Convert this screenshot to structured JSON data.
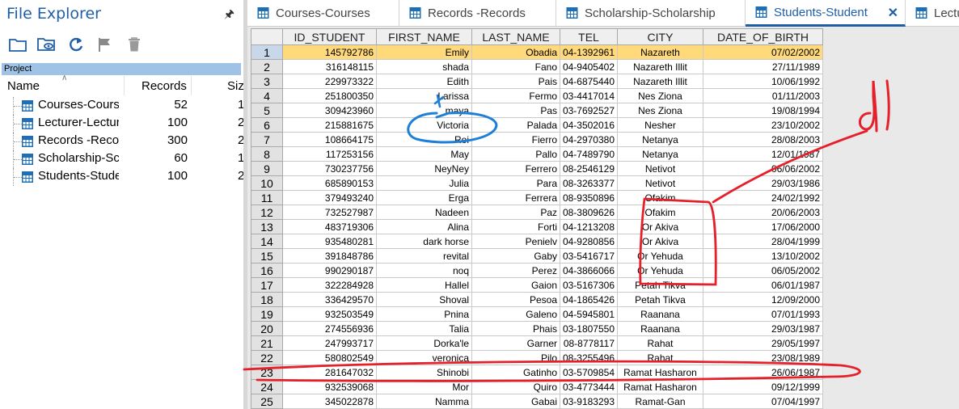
{
  "explorer": {
    "title": "File Explorer",
    "project_label": "Project",
    "columns": {
      "name": "Name",
      "records": "Records",
      "size": "Siz"
    },
    "toolbar": [
      {
        "icon": "open-folder-icon"
      },
      {
        "icon": "view-folder-icon"
      },
      {
        "icon": "refresh-icon"
      },
      {
        "icon": "flag-icon"
      },
      {
        "icon": "trash-icon"
      }
    ],
    "items": [
      {
        "name": "Courses-Courses",
        "records": "52",
        "size": "1"
      },
      {
        "name": "Lecturer-Lecturer",
        "records": "100",
        "size": "2"
      },
      {
        "name": "Records -Records",
        "records": "300",
        "size": "2"
      },
      {
        "name": "Scholarship-Scholarship",
        "records": "60",
        "size": "1"
      },
      {
        "name": "Students-Student",
        "records": "100",
        "size": "2"
      }
    ]
  },
  "tabs": [
    {
      "label": "Courses-Courses"
    },
    {
      "label": "Records -Records"
    },
    {
      "label": "Scholarship-Scholarship"
    },
    {
      "label": "Students-Student",
      "active": true
    },
    {
      "label": "Lectu"
    }
  ],
  "grid": {
    "columns": [
      "ID_STUDENT",
      "FIRST_NAME",
      "LAST_NAME",
      "TEL",
      "CITY",
      "DATE_OF_BIRTH"
    ],
    "rows": [
      [
        "1",
        "145792786",
        "Emily",
        "Obadia",
        "04-1392961",
        "Nazareth",
        "07/02/2002"
      ],
      [
        "2",
        "316148115",
        "shada",
        "Fano",
        "04-9405402",
        "Nazareth Illit",
        "27/11/1989"
      ],
      [
        "3",
        "229973322",
        "Edith",
        "Pais",
        "04-6875440",
        "Nazareth Illit",
        "10/06/1992"
      ],
      [
        "4",
        "251800350",
        "Larissa",
        "Fermo",
        "03-4417014",
        "Nes Ziona",
        "01/11/2003"
      ],
      [
        "5",
        "309423960",
        "maya",
        "Pas",
        "03-7692527",
        "Nes Ziona",
        "19/08/1994"
      ],
      [
        "6",
        "215881675",
        "Victoria",
        "Palada",
        "04-3502016",
        "Nesher",
        "23/10/2002"
      ],
      [
        "7",
        "108664175",
        "Roi",
        "Fierro",
        "04-2970380",
        "Netanya",
        "28/08/2003"
      ],
      [
        "8",
        "117253156",
        "May",
        "Pallo",
        "04-7489790",
        "Netanya",
        "12/01/1987"
      ],
      [
        "9",
        "730237756",
        "NeyNey",
        "Ferrero",
        "08-2546129",
        "Netivot",
        "06/06/2002"
      ],
      [
        "10",
        "685890153",
        "Julia",
        "Para",
        "08-3263377",
        "Netivot",
        "29/03/1986"
      ],
      [
        "11",
        "379493240",
        "Erga",
        "Ferrera",
        "08-9350896",
        "Ofakim",
        "24/02/1992"
      ],
      [
        "12",
        "732527987",
        "Nadeen",
        "Paz",
        "08-3809626",
        "Ofakim",
        "20/06/2003"
      ],
      [
        "13",
        "483719306",
        "Alina",
        "Forti",
        "04-1213208",
        "Or Akiva",
        "17/06/2000"
      ],
      [
        "14",
        "935480281",
        "dark horse",
        "Penielv",
        "04-9280856",
        "Or Akiva",
        "28/04/1999"
      ],
      [
        "15",
        "391848786",
        "revital",
        "Gaby",
        "03-5416717",
        "Or Yehuda",
        "13/10/2002"
      ],
      [
        "16",
        "990290187",
        "noq",
        "Perez",
        "04-3866066",
        "Or Yehuda",
        "06/05/2002"
      ],
      [
        "17",
        "322284928",
        "Hallel",
        "Gaion",
        "03-5167306",
        "Petah Tikva",
        "06/01/1987"
      ],
      [
        "18",
        "336429570",
        "Shoval",
        "Pesoa",
        "04-1865426",
        "Petah Tikva",
        "12/09/2000"
      ],
      [
        "19",
        "932503549",
        "Pnina",
        "Galeno",
        "04-5945801",
        "Raanana",
        "07/01/1993"
      ],
      [
        "20",
        "274556936",
        "Talia",
        "Phais",
        "03-1807550",
        "Raanana",
        "29/03/1987"
      ],
      [
        "21",
        "247993717",
        "Dorka'le",
        "Garner",
        "08-8778117",
        "Rahat",
        "29/05/1997"
      ],
      [
        "22",
        "580802549",
        "veronica",
        "Pilo",
        "08-3255496",
        "Rahat",
        "23/08/1989"
      ],
      [
        "23",
        "281647032",
        "Shinobi",
        "Gatinho",
        "03-5709854",
        "Ramat Hasharon",
        "26/06/1987"
      ],
      [
        "24",
        "932539068",
        "Mor",
        "Quiro",
        "03-4773444",
        "Ramat Hasharon",
        "09/12/1999"
      ],
      [
        "25",
        "345022878",
        "Namma",
        "Gabai",
        "03-9183293",
        "Ramat-Gan",
        "07/04/1997"
      ]
    ],
    "selected_row": 1
  },
  "annotations": {
    "handwriting": "dl",
    "ink_colors": {
      "red": "#e5202b",
      "blue": "#1e7fd8"
    }
  },
  "colors": {
    "accent": "#1f5fa8",
    "selected_row": "#ffd97a",
    "project_header": "#9fc3e7",
    "table_icon": "#1f6fb5"
  }
}
